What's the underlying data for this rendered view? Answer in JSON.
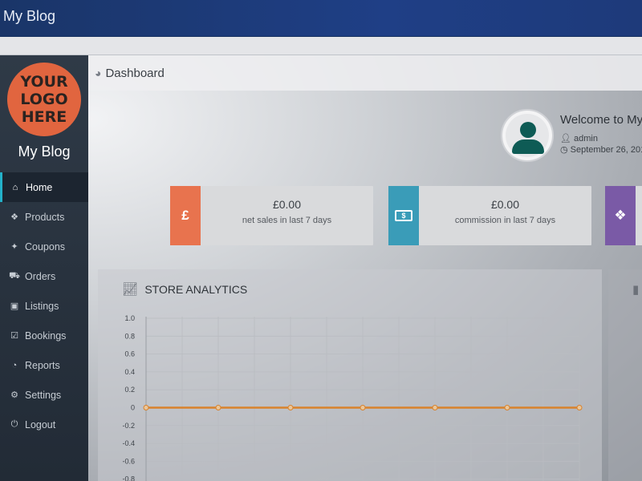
{
  "app": {
    "title": "My Blog"
  },
  "logo": {
    "line1": "YOUR",
    "line2": "LOGO",
    "line3": "HERE"
  },
  "sidebar": {
    "site_name": "My Blog",
    "items": [
      {
        "label": "Home",
        "icon": "home-icon",
        "glyph": "⌂",
        "active": true
      },
      {
        "label": "Products",
        "icon": "cubes-icon",
        "glyph": "❖",
        "active": false
      },
      {
        "label": "Coupons",
        "icon": "gift-icon",
        "glyph": "✦",
        "active": false
      },
      {
        "label": "Orders",
        "icon": "cart-icon",
        "glyph": "⛟",
        "active": false
      },
      {
        "label": "Listings",
        "icon": "briefcase-icon",
        "glyph": "▣",
        "active": false
      },
      {
        "label": "Bookings",
        "icon": "calendar-check-icon",
        "glyph": "☑",
        "active": false
      },
      {
        "label": "Reports",
        "icon": "pie-chart-icon",
        "glyph": "◔",
        "active": false
      },
      {
        "label": "Settings",
        "icon": "cogs-icon",
        "glyph": "⚙",
        "active": false
      },
      {
        "label": "Logout",
        "icon": "power-icon",
        "glyph": "⏻",
        "active": false
      }
    ]
  },
  "header": {
    "title": "Dashboard",
    "icon": "dashboard-gauge-icon"
  },
  "welcome": {
    "text": "Welcome to My",
    "user": "admin",
    "date": "September 26, 201"
  },
  "cards": [
    {
      "amount": "£0.00",
      "label": "net sales in last 7 days",
      "icon": "pound-icon",
      "glyph": "£",
      "color": "#e8734e"
    },
    {
      "amount": "£0.00",
      "label": "commission in last 7 days",
      "icon": "money-icon",
      "glyph": "▭",
      "color": "#3a9cb8"
    },
    {
      "amount": "",
      "label": "",
      "icon": "cubes-icon",
      "glyph": "❖",
      "color": "#7a5aa6"
    }
  ],
  "analytics": {
    "title": "STORE ANALYTICS",
    "icon": "line-chart-icon"
  },
  "chart_data": {
    "type": "line",
    "title": "STORE ANALYTICS",
    "xlabel": "",
    "ylabel": "",
    "ylim": [
      -0.8,
      1.0
    ],
    "yticks": [
      "1.0",
      "0.8",
      "0.6",
      "0.4",
      "0.2",
      "0",
      "-0.2",
      "-0.4",
      "-0.6",
      "-0.8"
    ],
    "x": [
      1,
      2,
      3,
      4,
      5,
      6,
      7
    ],
    "series": [
      {
        "name": "",
        "values": [
          0,
          0,
          0,
          0,
          0,
          0,
          0
        ],
        "color": "#d9822b"
      }
    ],
    "grid": true
  },
  "colors": {
    "accent": "#23b1c9",
    "topbar": "#1f3f86"
  }
}
